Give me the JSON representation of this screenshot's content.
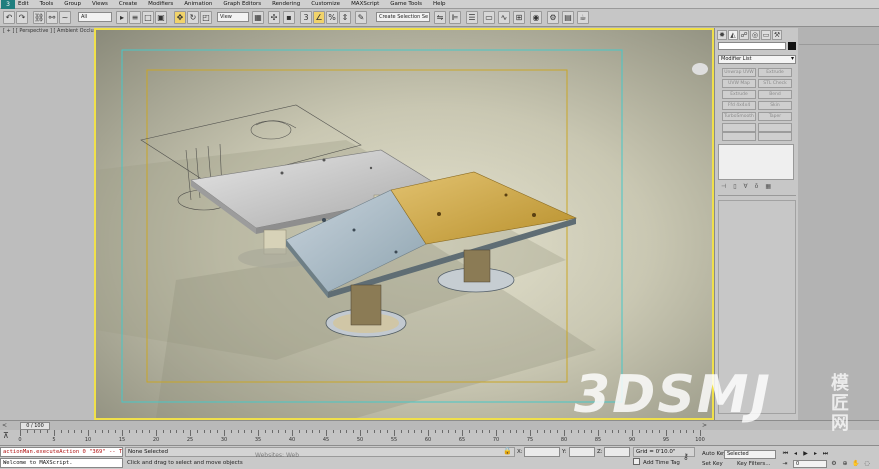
{
  "menubar": {
    "logo": "3",
    "items": [
      "Edit",
      "Tools",
      "Group",
      "Views",
      "Create",
      "Modifiers",
      "Animation",
      "Graph Editors",
      "Rendering",
      "Customize",
      "MAXScript",
      "Game Tools",
      "Help"
    ]
  },
  "toolbar": {
    "filter_value": "All",
    "coord_system": "View",
    "named_selection_placeholder": "Create Selection Se"
  },
  "viewport": {
    "label": "[ + ] [ Perspective ] [ Ambient Occlusion + Hw ]",
    "border_color": "#f0e04a"
  },
  "command_panel": {
    "modifier_list": "Modifier List",
    "modifier_buttons": [
      "Unwrap UVW",
      "Extrude",
      "UVW Map",
      "STL Check",
      "Extrude",
      "Bend",
      "Ffd 4x4x4",
      "Skin",
      "TurboSmooth",
      "Taper"
    ]
  },
  "time_slider": {
    "position": "0 / 100",
    "prev": "<",
    "next": ">"
  },
  "track": {
    "labels": [
      "0",
      "5",
      "10",
      "15",
      "20",
      "25",
      "30",
      "35",
      "40",
      "45",
      "50",
      "55",
      "60",
      "65",
      "70",
      "75",
      "80",
      "85",
      "90",
      "95",
      "100"
    ]
  },
  "status": {
    "listener_line_1": "actionMan.executeAction 0 \"369\"  -- T",
    "listener_line_2": "Welcome to MAXScript.",
    "selection": "None Selected",
    "prompt": "Click and drag to select and move objects",
    "x_label": "X:",
    "y_label": "Y:",
    "z_label": "Z:",
    "grid": "Grid = 0'10.0\"",
    "add_time_tag": "Add Time Tag",
    "auto_key": "Auto Key",
    "set_key": "Set Key",
    "selected_option": "Selected",
    "key_filters": "Key Filters...",
    "frame_value": "0"
  },
  "watermark": {
    "text": "3DSMJ",
    "cjk": "模匠网",
    "website": "Websites: Web"
  }
}
